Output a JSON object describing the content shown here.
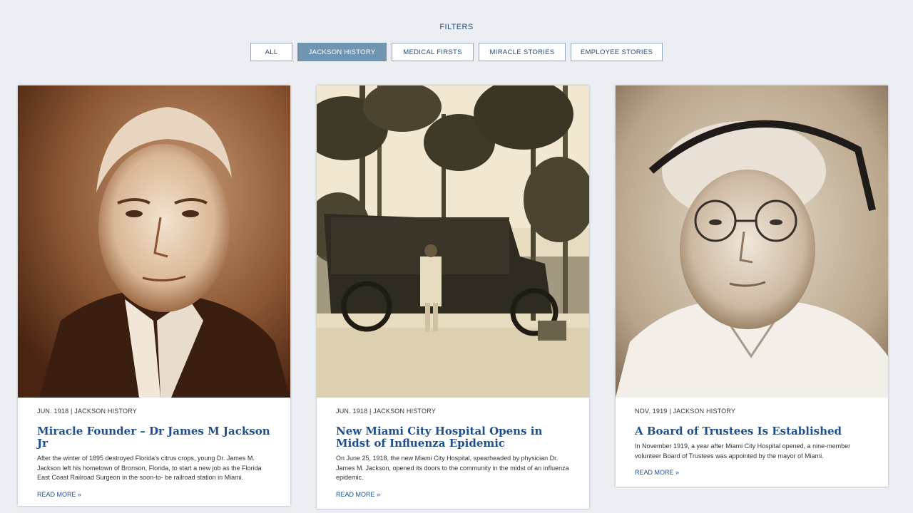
{
  "filters": {
    "title": "FILTERS",
    "buttons": [
      {
        "label": "ALL",
        "active": false
      },
      {
        "label": "JACKSON HISTORY",
        "active": true
      },
      {
        "label": "MEDICAL FIRSTS",
        "active": false
      },
      {
        "label": "MIRACLE STORIES",
        "active": false
      },
      {
        "label": "EMPLOYEE STORIES",
        "active": false
      }
    ]
  },
  "cards": [
    {
      "meta": "JUN. 1918 | JACKSON HISTORY",
      "title": "Miracle Founder – Dr James M Jackson Jr",
      "excerpt": "After the winter of 1895 destroyed Florida's citrus crops, young Dr. James M. Jackson left his hometown of Bronson, Florida, to start a new job as the Florida East Coast Railroad Surgeon in the soon-to- be railroad station in Miami.",
      "read_more": "READ MORE »"
    },
    {
      "meta": "JUN. 1918 | JACKSON HISTORY",
      "title": "New Miami City Hospital Opens in Midst of Influenza Epidemic",
      "excerpt": "On June 25, 1918, the new Miami City Hospital, spearheaded by physician Dr. James M. Jackson, opened its doors to the community in the midst of an influenza epidemic.",
      "read_more": "READ MORE »"
    },
    {
      "meta": "NOV. 1919 | JACKSON HISTORY",
      "title": "A Board of Trustees Is Established",
      "excerpt": "In November 1919, a year after Miami City Hospital opened, a nine-member volunteer Board of Trustees was appointed by the mayor of Miami.",
      "read_more": "READ MORE »"
    }
  ],
  "colors": {
    "background": "#ebeff3",
    "accent": "#1d4f8c",
    "active_filter": "#6f95b3"
  }
}
